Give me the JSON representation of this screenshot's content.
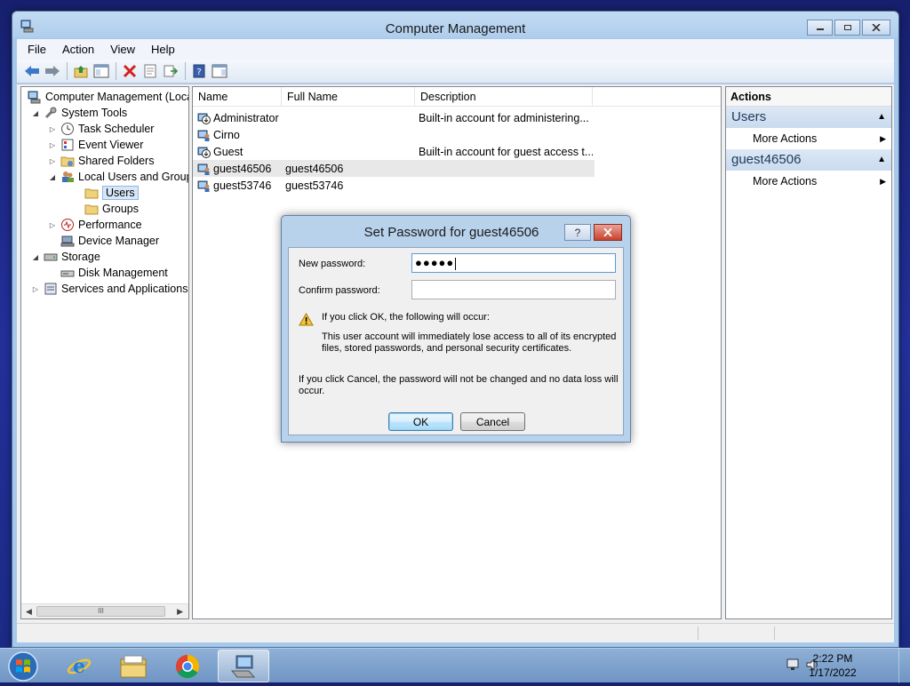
{
  "window": {
    "title": "Computer Management"
  },
  "menu": [
    "File",
    "Action",
    "View",
    "Help"
  ],
  "tree": [
    {
      "label": "Computer Management (Local",
      "level": 0,
      "expander": "",
      "icon": "computer-management-icon"
    },
    {
      "label": "System Tools",
      "level": 1,
      "expander": "◢",
      "icon": "system-tools-icon"
    },
    {
      "label": "Task Scheduler",
      "level": 2,
      "expander": "▷",
      "icon": "clock-icon"
    },
    {
      "label": "Event Viewer",
      "level": 2,
      "expander": "▷",
      "icon": "event-viewer-icon"
    },
    {
      "label": "Shared Folders",
      "level": 2,
      "expander": "▷",
      "icon": "shared-folder-icon"
    },
    {
      "label": "Local Users and Groups",
      "level": 2,
      "expander": "◢",
      "icon": "users-groups-icon"
    },
    {
      "label": "Users",
      "level": 3,
      "expander": "",
      "icon": "folder-icon",
      "selected": true
    },
    {
      "label": "Groups",
      "level": 3,
      "expander": "",
      "icon": "folder-icon"
    },
    {
      "label": "Performance",
      "level": 2,
      "expander": "▷",
      "icon": "performance-icon"
    },
    {
      "label": "Device Manager",
      "level": 2,
      "expander": "",
      "icon": "device-manager-icon"
    },
    {
      "label": "Storage",
      "level": 1,
      "expander": "◢",
      "icon": "storage-icon"
    },
    {
      "label": "Disk Management",
      "level": 2,
      "expander": "",
      "icon": "disk-icon"
    },
    {
      "label": "Services and Applications",
      "level": 1,
      "expander": "▷",
      "icon": "services-icon"
    }
  ],
  "list": {
    "columns": [
      "Name",
      "Full Name",
      "Description"
    ],
    "rows": [
      {
        "name": "Administrator",
        "full": "",
        "desc": "Built-in account for administering...",
        "icon": "disabled-user-icon"
      },
      {
        "name": "Cirno",
        "full": "",
        "desc": "",
        "icon": "user-icon"
      },
      {
        "name": "Guest",
        "full": "",
        "desc": "Built-in account for guest access t...",
        "icon": "disabled-user-icon"
      },
      {
        "name": "guest46506",
        "full": "guest46506",
        "desc": "",
        "icon": "user-icon",
        "highlight": true
      },
      {
        "name": "guest53746",
        "full": "guest53746",
        "desc": "",
        "icon": "user-icon"
      }
    ]
  },
  "actions": {
    "title": "Actions",
    "sections": [
      {
        "name": "Users",
        "items": [
          "More Actions"
        ]
      },
      {
        "name": "guest46506",
        "items": [
          "More Actions"
        ]
      }
    ]
  },
  "dialog": {
    "title": "Set Password for guest46506",
    "help_glyph": "?",
    "new_password_label": "New password:",
    "new_password_value": "●●●●●",
    "confirm_password_label": "Confirm password:",
    "confirm_password_value": "",
    "warning_heading": "If you click OK, the following will occur:",
    "warning_line1": "This user account will immediately lose access to all of its encrypted",
    "warning_line2": "files, stored passwords, and personal security certificates.",
    "cancel_note_line1": "If you click Cancel, the password will not be changed and no data loss will",
    "cancel_note_line2": "occur.",
    "ok_label": "OK",
    "cancel_label": "Cancel"
  },
  "scrollbar": {
    "thumb_glyph": "III"
  },
  "taskbar": {
    "apps": [
      "internet-explorer-icon",
      "file-explorer-icon",
      "chrome-icon",
      "computer-management-icon"
    ],
    "time": "2:22 PM",
    "date": "1/17/2022"
  }
}
